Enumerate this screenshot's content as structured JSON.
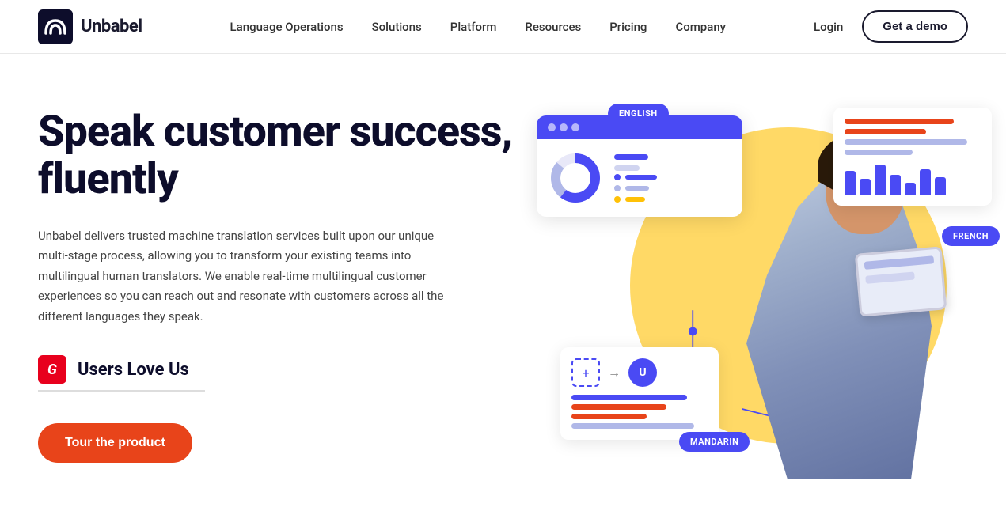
{
  "nav": {
    "logo_text": "Unbabel",
    "links": [
      {
        "label": "Language Operations",
        "id": "language-operations"
      },
      {
        "label": "Solutions",
        "id": "solutions"
      },
      {
        "label": "Platform",
        "id": "platform"
      },
      {
        "label": "Resources",
        "id": "resources"
      },
      {
        "label": "Pricing",
        "id": "pricing"
      },
      {
        "label": "Company",
        "id": "company"
      }
    ],
    "login_label": "Login",
    "demo_label": "Get a demo"
  },
  "hero": {
    "title": "Speak customer success, fluently",
    "description": "Unbabel delivers trusted machine translation services built upon our unique multi-stage process, allowing you to transform your existing teams into multilingual human translators. We enable real-time multilingual customer experiences so you can reach out and resonate with customers across all the different languages they speak.",
    "badge_icon": "G",
    "badge_text": "Users Love Us",
    "cta_label": "Tour the product"
  },
  "illustration": {
    "languages": [
      "ENGLISH",
      "FRENCH",
      "MANDARIN"
    ]
  },
  "colors": {
    "primary": "#4a4af4",
    "accent": "#e8441a",
    "yellow": "#ffd966",
    "orange_bar": "#e8441a",
    "blue_bar": "#4a4af4",
    "light_bar": "#b0b8e8"
  }
}
